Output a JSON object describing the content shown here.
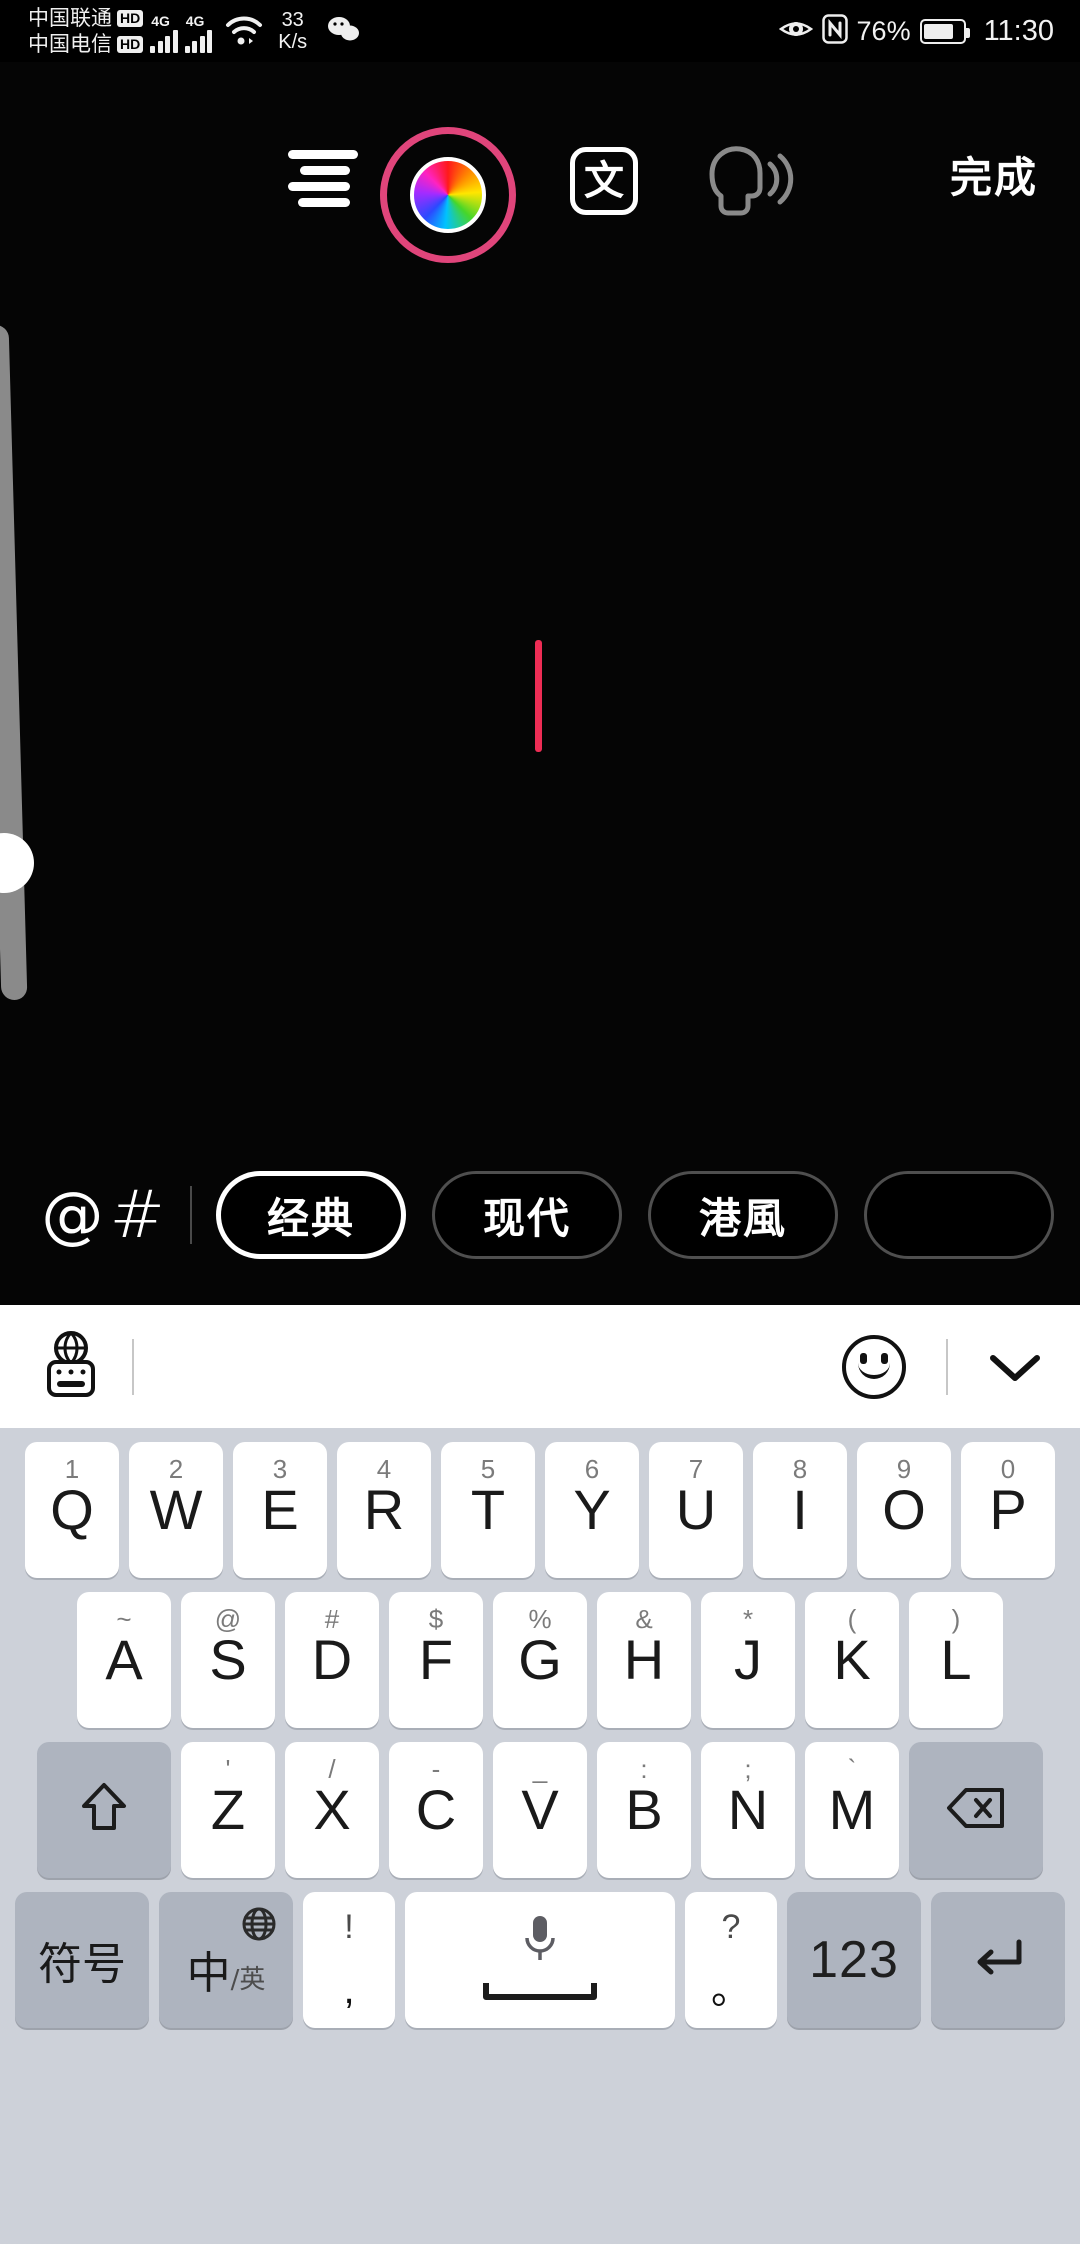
{
  "status_bar": {
    "carriers": [
      {
        "name": "中国联通",
        "badge": "HD"
      },
      {
        "name": "中国电信",
        "badge": "HD"
      }
    ],
    "network_type_1": "4G",
    "network_type_2": "4G",
    "net_speed_value": "33",
    "net_speed_unit": "K/s",
    "icons": [
      "wifi-icon",
      "wechat-icon",
      "eye-comfort-icon",
      "nfc-icon"
    ],
    "battery_percent": "76%",
    "time": "11:30"
  },
  "editor": {
    "toolbar": {
      "align_icon": "text-align-icon",
      "color_wheel_label": "color-wheel-icon",
      "color_ring_hex": "#e0457b",
      "font_button_label": "文",
      "tts_icon": "text-to-speech-icon",
      "done_label": "完成"
    },
    "cursor_color": "#ee2d55",
    "slider": {
      "name": "vertical-size-slider"
    },
    "style_bar": {
      "mention_symbol": "@",
      "hashtag_symbol": "#",
      "chips": [
        {
          "label": "经典",
          "selected": true
        },
        {
          "label": "现代",
          "selected": false
        },
        {
          "label": "港風",
          "selected": false
        },
        {
          "label": "",
          "selected": false
        }
      ]
    }
  },
  "keyboard": {
    "toolbar": {
      "language_switch_icon": "globe-keyboard-icon",
      "emoji_icon": "smiley-icon",
      "collapse_icon": "chevron-down-icon"
    },
    "row1": [
      {
        "sup": "1",
        "key": "Q"
      },
      {
        "sup": "2",
        "key": "W"
      },
      {
        "sup": "3",
        "key": "E"
      },
      {
        "sup": "4",
        "key": "R"
      },
      {
        "sup": "5",
        "key": "T"
      },
      {
        "sup": "6",
        "key": "Y"
      },
      {
        "sup": "7",
        "key": "U"
      },
      {
        "sup": "8",
        "key": "I"
      },
      {
        "sup": "9",
        "key": "O"
      },
      {
        "sup": "0",
        "key": "P"
      }
    ],
    "row2": [
      {
        "sup": "~",
        "key": "A"
      },
      {
        "sup": "@",
        "key": "S"
      },
      {
        "sup": "#",
        "key": "D"
      },
      {
        "sup": "$",
        "key": "F"
      },
      {
        "sup": "%",
        "key": "G"
      },
      {
        "sup": "&",
        "key": "H"
      },
      {
        "sup": "*",
        "key": "J"
      },
      {
        "sup": "(",
        "key": "K"
      },
      {
        "sup": ")",
        "key": "L"
      }
    ],
    "row3": {
      "shift": "shift-icon",
      "keys": [
        {
          "sup": "'",
          "key": "Z"
        },
        {
          "sup": "/",
          "key": "X"
        },
        {
          "sup": "-",
          "key": "C"
        },
        {
          "sup": "_",
          "key": "V"
        },
        {
          "sup": ":",
          "key": "B"
        },
        {
          "sup": ";",
          "key": "N"
        },
        {
          "sup": "`",
          "key": "M"
        }
      ],
      "backspace": "backspace-icon"
    },
    "row4": {
      "symbols_label": "符号",
      "lang_main": "中",
      "lang_sub": "/英",
      "globe_icon": "globe-icon",
      "comma_top": "!",
      "comma_bottom": ",",
      "space_icon": "microphone-icon",
      "period_top": "?",
      "period_bottom": "。",
      "numeric_label": "123",
      "enter_icon": "enter-icon"
    }
  }
}
